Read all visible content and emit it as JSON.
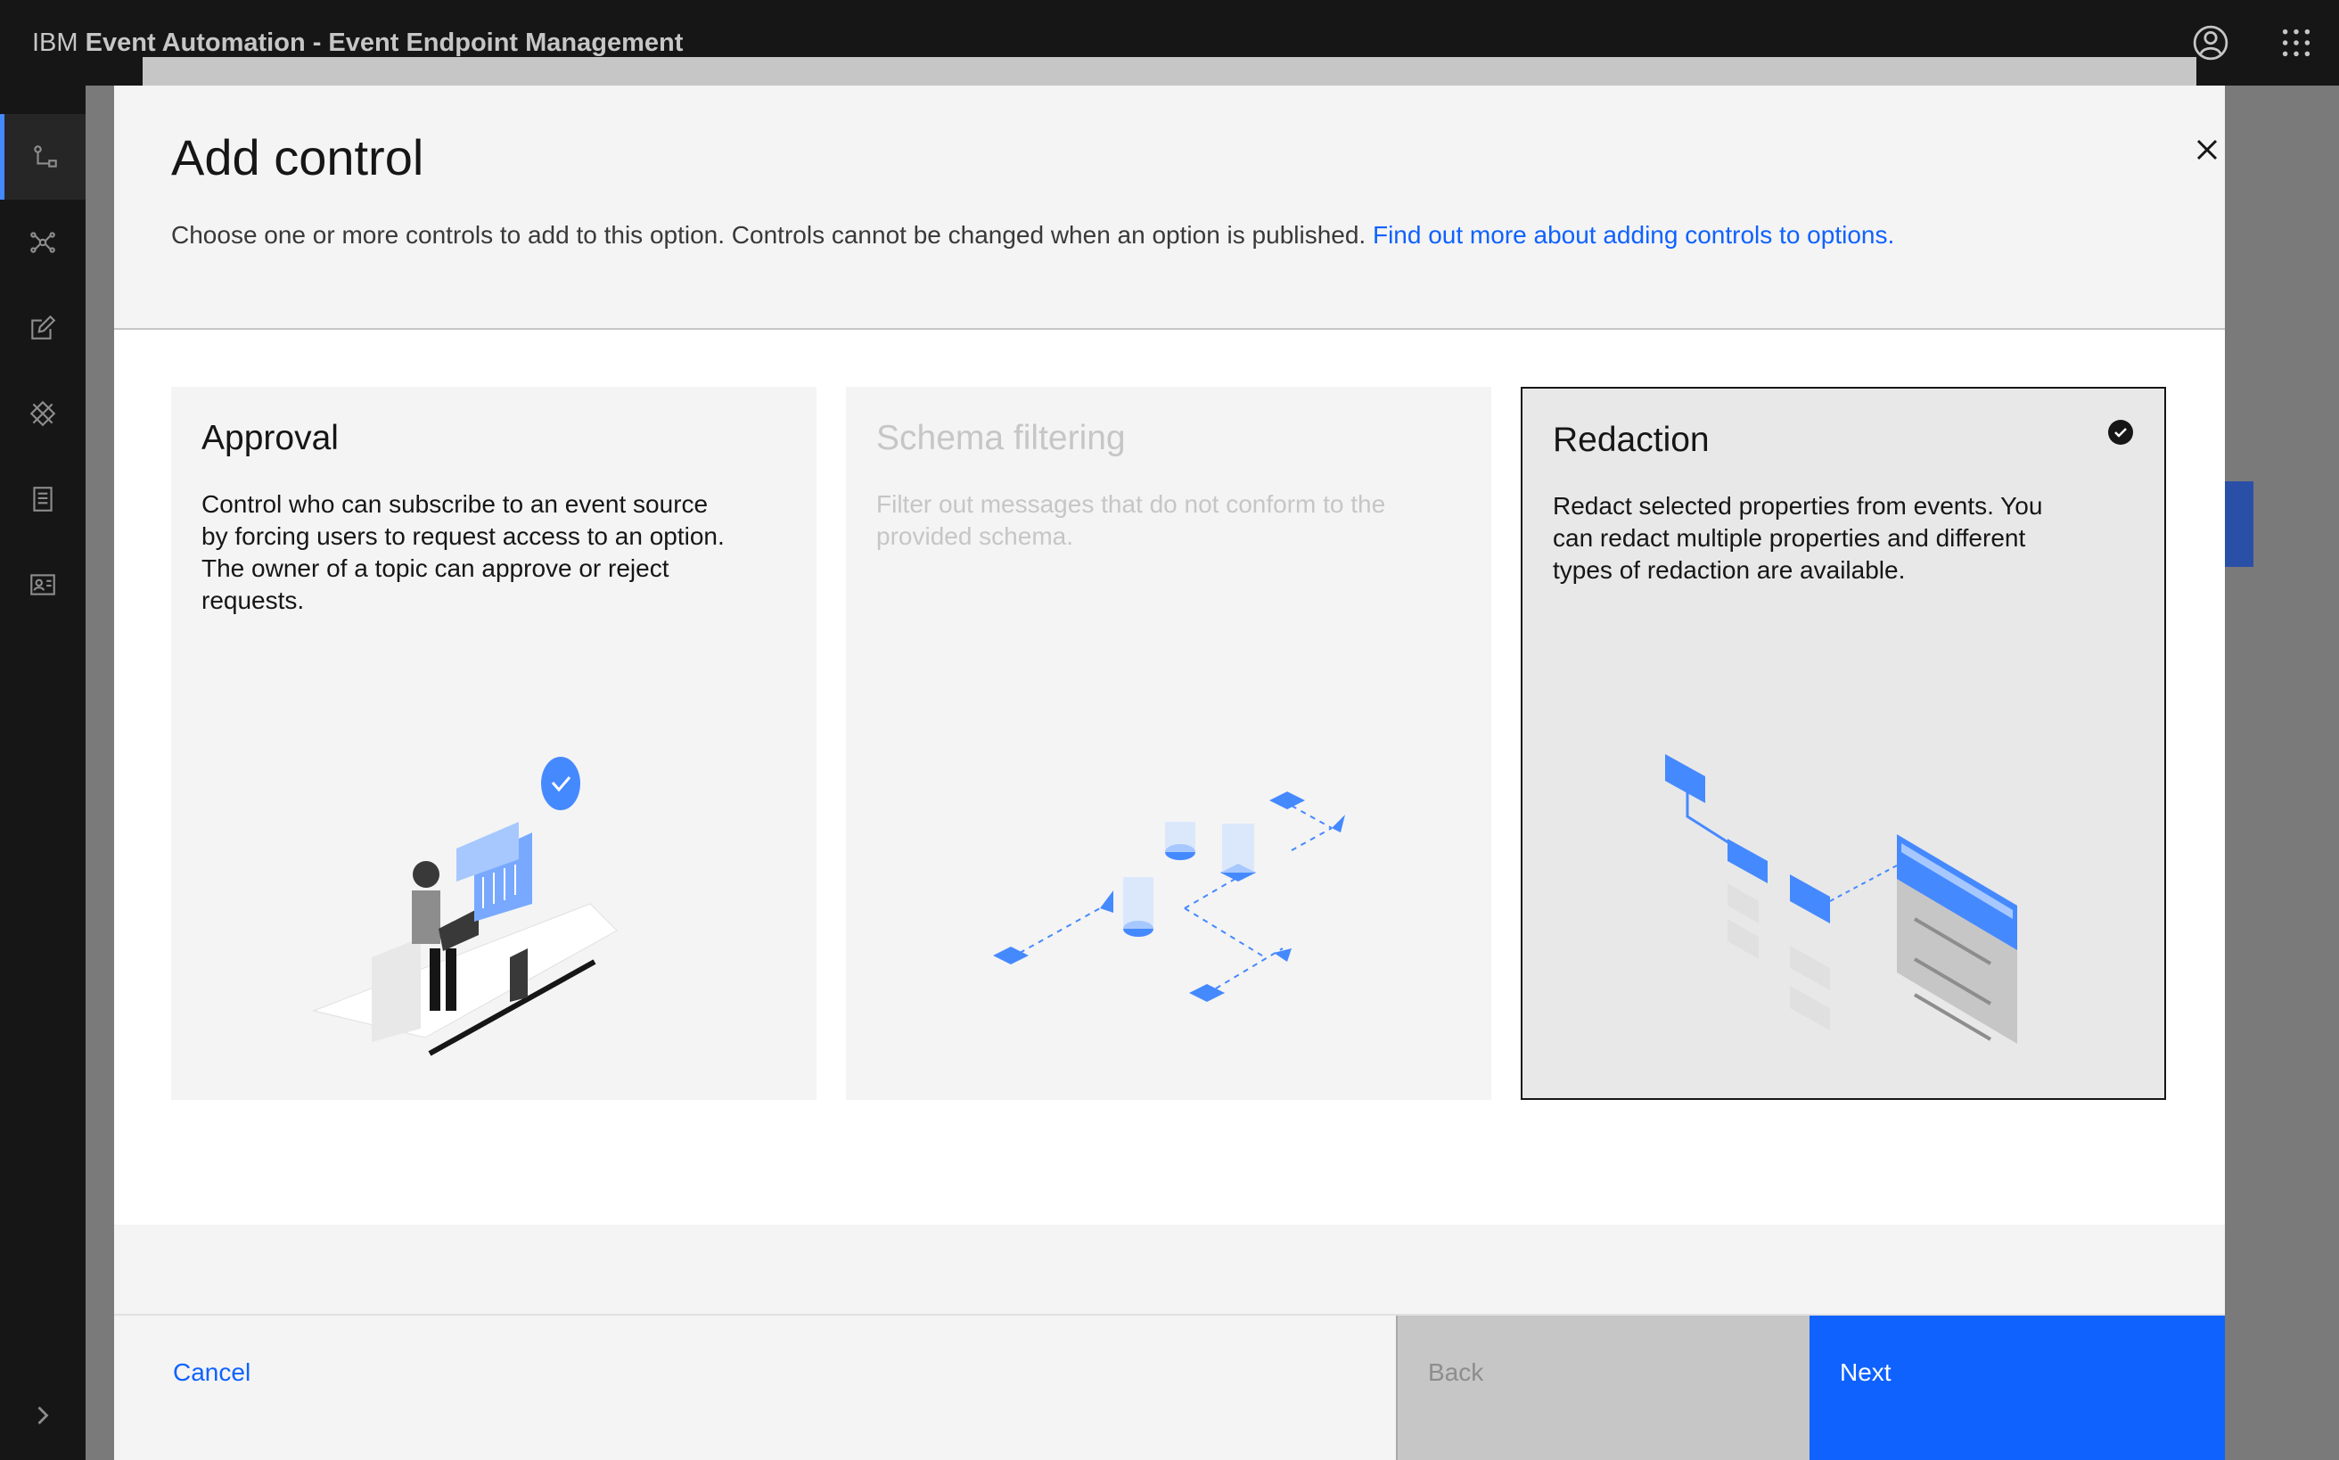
{
  "header": {
    "brand_prefix": "IBM",
    "brand_name": "Event Automation - Event Endpoint Management",
    "icons": [
      "user-avatar-icon",
      "app-switcher-icon"
    ]
  },
  "sidenav": {
    "items": [
      {
        "icon": "topology-icon",
        "active": true
      },
      {
        "icon": "catalog-network-icon",
        "active": false
      },
      {
        "icon": "edit-icon",
        "active": false
      },
      {
        "icon": "gateway-icon",
        "active": false
      },
      {
        "icon": "document-list-icon",
        "active": false
      },
      {
        "icon": "profile-card-icon",
        "active": false
      }
    ],
    "expand_icon": "chevron-right-icon"
  },
  "modal": {
    "title": "Add control",
    "description": "Choose one or more controls to add to this option. Controls cannot be changed when an option is published. ",
    "link_text": "Find out more about adding controls to options.",
    "tiles": [
      {
        "title": "Approval",
        "description": "Control who can subscribe to an event source by forcing users to request access to an option. The owner of a topic can approve or reject requests.",
        "state": "available"
      },
      {
        "title": "Schema filtering",
        "description": "Filter out messages that do not conform to the provided schema.",
        "state": "disabled"
      },
      {
        "title": "Redaction",
        "description": "Redact selected properties from events. You can redact multiple properties and different types of redaction are available.",
        "state": "selected"
      }
    ],
    "footer": {
      "cancel_label": "Cancel",
      "back_label": "Back",
      "next_label": "Next"
    }
  },
  "colors": {
    "primary": "#0f62fe",
    "header_bg": "#161616",
    "modal_bg": "#f4f4f4",
    "disabled_text": "#c6c6c6"
  }
}
